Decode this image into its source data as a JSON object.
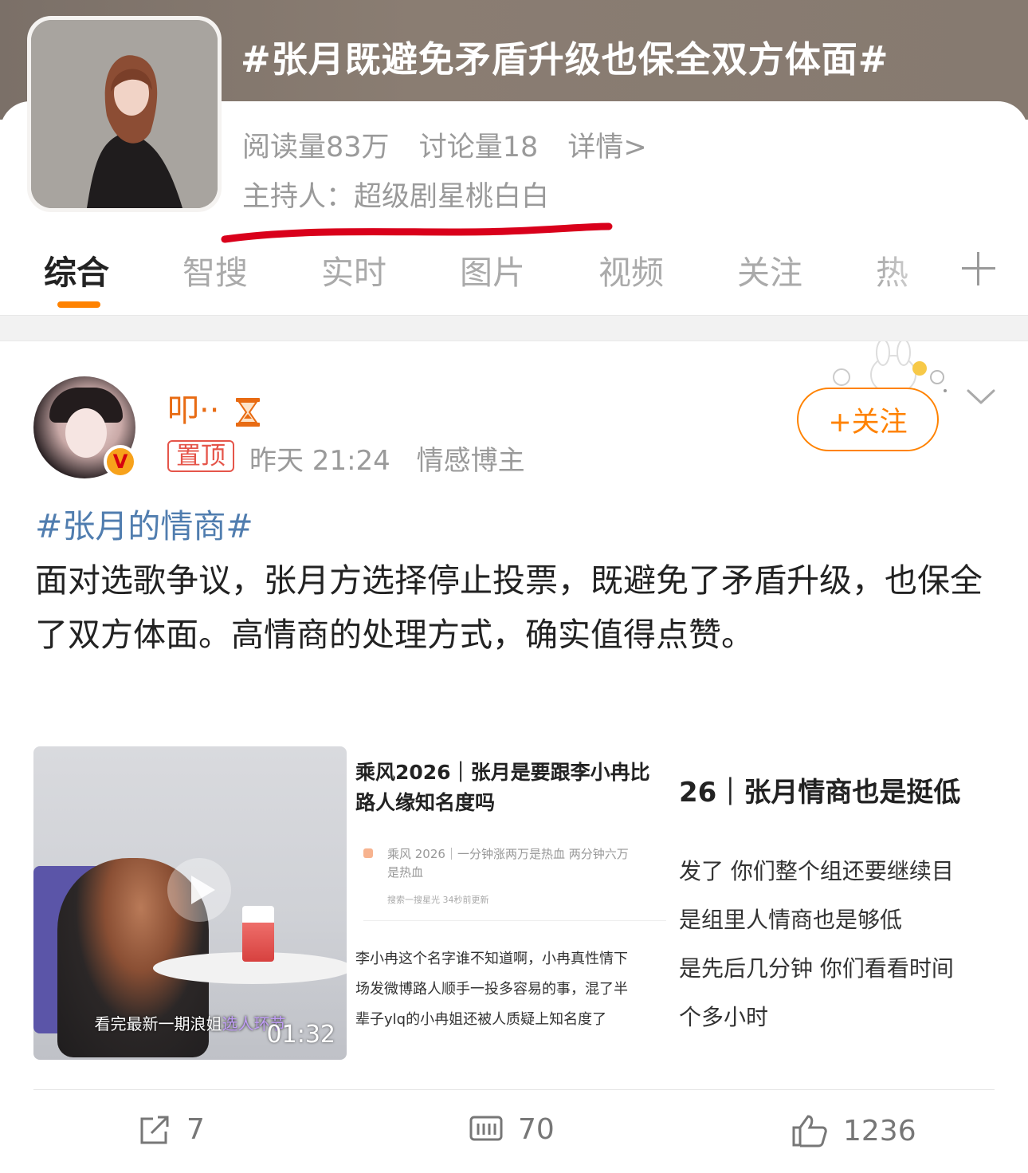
{
  "topic": {
    "title": "#张月既避免矛盾升级也保全双方体面#",
    "reads": "阅读量83万",
    "discussions": "讨论量18",
    "details_link": "详情>",
    "host_label": "主持人：",
    "host_name": "超级剧星桃白白"
  },
  "tabs": [
    {
      "label": "综合"
    },
    {
      "label": "智搜"
    },
    {
      "label": "实时"
    },
    {
      "label": "图片"
    },
    {
      "label": "视频"
    },
    {
      "label": "关注"
    },
    {
      "label": "热"
    }
  ],
  "post": {
    "username": "叩··",
    "pinned_badge": "置顶",
    "time": "昨天 21:24",
    "tag": "情感博主",
    "follow_label": "+关注",
    "hashtag": "#张月的情商#",
    "text": "面对选歌争议，张月方选择停止投票，既避免了矛盾升级，也保全了双方体面。高情商的处理方式，确实值得点赞。",
    "verified_badge": "V"
  },
  "media": {
    "video_caption_plain": "看完最新一期浪姐",
    "video_caption_highlight": "选人环节",
    "video_duration": "01:32",
    "screenshot1": {
      "headline_line1": "乘风2026｜张月是要跟李小冉比",
      "headline_line2": "路人缘知名度吗",
      "sub_line1": "乘风 2026｜一分钟涨两万是热血 两分钟六万",
      "sub_line2": "是热血",
      "small_meta": "搜索一搜星光   34秒前更新",
      "body_line1": "李小冉这个名字谁不知道啊，小冉真性情下",
      "body_line2": "场发微博路人顺手一投多容易的事，混了半",
      "body_line3": "辈子ylq的小冉姐还被人质疑上知名度了"
    },
    "screenshot2": {
      "headline": "26｜张月情商也是挺低",
      "body_line1": "发了 你们整个组还要继续目",
      "body_line2": "是组里人情商也是够低",
      "body_line3": "是先后几分钟 你们看看时间",
      "body_line4": "个多小时"
    }
  },
  "actions": {
    "reposts": "7",
    "comments": "70",
    "likes": "1236"
  },
  "colors": {
    "accent": "#ff8200",
    "username": "#e86b13",
    "hashtag": "#507daf",
    "annotation_red": "#d9001b"
  }
}
